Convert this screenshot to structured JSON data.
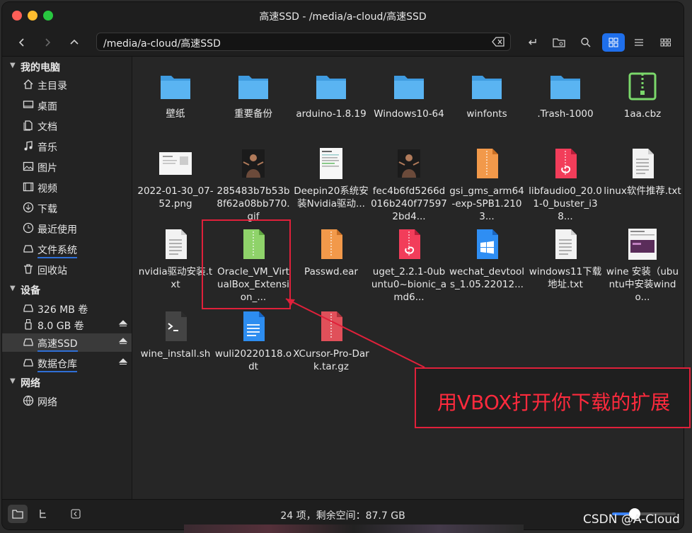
{
  "window": {
    "title": "高速SSD - /media/a-cloud/高速SSD",
    "traffic_colors": [
      "#fe5f57",
      "#febc2e",
      "#28c840"
    ]
  },
  "toolbar": {
    "path": "/media/a-cloud/高速SSD"
  },
  "sidebar": {
    "groups": [
      {
        "label": "我的电脑",
        "items": [
          {
            "label": "主目录",
            "icon": "home-icon"
          },
          {
            "label": "桌面",
            "icon": "desktop-icon"
          },
          {
            "label": "文档",
            "icon": "document-icon"
          },
          {
            "label": "音乐",
            "icon": "music-icon"
          },
          {
            "label": "图片",
            "icon": "picture-icon"
          },
          {
            "label": "视频",
            "icon": "video-icon"
          },
          {
            "label": "下载",
            "icon": "download-icon"
          },
          {
            "label": "最近使用",
            "icon": "clock-icon"
          },
          {
            "label": "文件系统",
            "icon": "drive-icon"
          },
          {
            "label": "回收站",
            "icon": "trash-icon"
          }
        ]
      },
      {
        "label": "设备",
        "items": [
          {
            "label": "326 MB 卷",
            "icon": "drive-icon"
          },
          {
            "label": "8.0 GB 卷",
            "icon": "usb-icon"
          },
          {
            "label": "高速SSD",
            "icon": "drive-icon"
          },
          {
            "label": "数据仓库",
            "icon": "drive-icon"
          }
        ]
      },
      {
        "label": "网络",
        "items": [
          {
            "label": "网络",
            "icon": "network-icon"
          }
        ]
      }
    ]
  },
  "files": [
    {
      "name": "壁纸",
      "type": "folder"
    },
    {
      "name": "重要备份",
      "type": "folder"
    },
    {
      "name": "arduino-1.8.19",
      "type": "folder"
    },
    {
      "name": "Windows10-64",
      "type": "folder"
    },
    {
      "name": "winfonts",
      "type": "folder"
    },
    {
      "name": ".Trash-1000",
      "type": "folder"
    },
    {
      "name": "1aa.cbz",
      "type": "archive-green"
    },
    {
      "name": "2022-01-30_07-52.png",
      "type": "image-screenshot"
    },
    {
      "name": "285483b7b53b8f62a08bb770.gif",
      "type": "image-photo"
    },
    {
      "name": "Deepin20系统安装Nvidia驱动...",
      "type": "image-doc"
    },
    {
      "name": "fec4b6fd5266d016b240f775972bd4...",
      "type": "image-photo"
    },
    {
      "name": "gsi_gms_arm64-exp-SPB1.2103...",
      "type": "package-orange"
    },
    {
      "name": "libfaudio0_20.01-0_buster_i38...",
      "type": "package-deb"
    },
    {
      "name": "linux软件推荐.txt",
      "type": "text"
    },
    {
      "name": "nvidia驱动安装.txt",
      "type": "text"
    },
    {
      "name": "Oracle_VM_VirtualBox_Extension_...",
      "type": "package-green"
    },
    {
      "name": "Passwd.ear",
      "type": "package-orange"
    },
    {
      "name": "uget_2.2.1-0ubuntu0~bionic_amd6...",
      "type": "package-deb"
    },
    {
      "name": "wechat_devtools_1.05.22012...",
      "type": "package-windows"
    },
    {
      "name": "windows11下载地址.txt",
      "type": "text"
    },
    {
      "name": "wine 安装（ubuntu中安装windo...",
      "type": "image-doc2"
    },
    {
      "name": "wine_install.sh",
      "type": "script"
    },
    {
      "name": "wuli20220118.odt",
      "type": "odt"
    },
    {
      "name": "XCursor-Pro-Dark.tar.gz",
      "type": "archive-red"
    }
  ],
  "status": {
    "text": "24 项，剩余空间：87.7 GB"
  },
  "annotation": {
    "callout_text": "用VBOX打开你下载的扩展",
    "color": "#e0203a"
  },
  "watermark": "CSDN @A-Cloud"
}
